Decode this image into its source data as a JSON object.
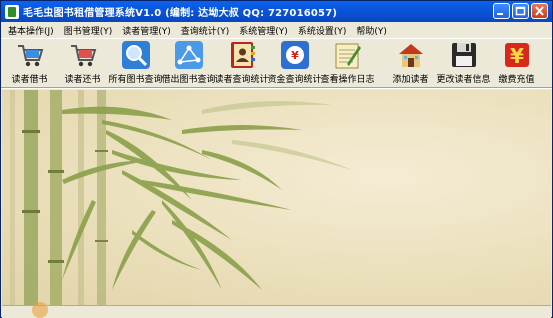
{
  "window": {
    "title": "毛毛虫图书租借管理系统V1.0 (编制: 达坳大叔  QQ: 727016057)"
  },
  "menu": [
    {
      "label": "基本操作(J)"
    },
    {
      "label": "图书管理(Y)"
    },
    {
      "label": "读者管理(Y)"
    },
    {
      "label": "查询统计(Y)"
    },
    {
      "label": "系统管理(Y)"
    },
    {
      "label": "系统设置(Y)"
    },
    {
      "label": "帮助(Y)"
    }
  ],
  "toolbar": [
    {
      "label": "读者借书",
      "icon": "cart-icon"
    },
    {
      "label": "读者还书",
      "icon": "cart-return-icon"
    },
    {
      "label": "所有图书查询",
      "icon": "search-icon"
    },
    {
      "label": "借出图书查询",
      "icon": "network-icon"
    },
    {
      "label": "读者查询统计",
      "icon": "address-book-icon"
    },
    {
      "label": "资金查询统计",
      "icon": "yen-shield-icon"
    },
    {
      "label": "查看操作日志",
      "icon": "notepad-icon"
    },
    {
      "label": "添加读者",
      "icon": "house-icon"
    },
    {
      "label": "更改读者信息",
      "icon": "floppy-icon"
    },
    {
      "label": "缴费充值",
      "icon": "yen-icon"
    }
  ],
  "colors": {
    "titlebar": "#0a54d8",
    "canvas": "#ede2c0",
    "bamboo": "#8aa04a"
  }
}
